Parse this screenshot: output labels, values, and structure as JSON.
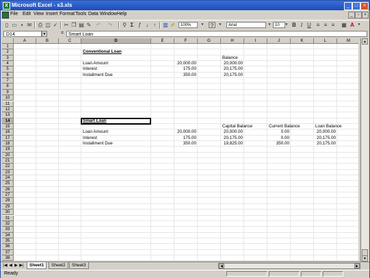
{
  "window": {
    "title": "Microsoft Excel - s3.xls"
  },
  "menu": [
    "File",
    "Edit",
    "View",
    "Insert",
    "Format",
    "Tools",
    "Data",
    "Window",
    "Help"
  ],
  "toolbar": {
    "zoom": "100%",
    "font": "Arial",
    "size": "10",
    "help": "?"
  },
  "formula_bar": {
    "name_box": "D14",
    "eq": "=",
    "content": "Smart Loan"
  },
  "columns": [
    "A",
    "B",
    "C",
    "D",
    "E",
    "F",
    "G",
    "H",
    "I",
    "J",
    "K",
    "L",
    "M",
    "N"
  ],
  "rows": [
    "1",
    "2",
    "3",
    "4",
    "5",
    "6",
    "7",
    "8",
    "9",
    "10",
    "11",
    "12",
    "13",
    "14",
    "15",
    "16",
    "17",
    "18",
    "19",
    "20",
    "21",
    "22",
    "23",
    "24",
    "25",
    "26",
    "27",
    "28",
    "29",
    "30",
    "31",
    "32",
    "33",
    "34",
    "35",
    "36",
    "37",
    "38"
  ],
  "cells": {
    "D2": "Conventional Loan",
    "H3": "Balance",
    "D4": "Loan Amount",
    "F4": "20,000.00",
    "H4": "20,000.00",
    "D5": "Interest",
    "F5": "175.00",
    "H5": "20,175.00",
    "D6": "Installment Due",
    "F6": "350.00",
    "H6": "20,175.00",
    "D14": "Smart Loan",
    "H15": "Capital Balance",
    "J15": "Current Balance",
    "L15": "Loan Balance",
    "D16": "Loan Amount",
    "F16": "20,000.00",
    "H16": "20,000.00",
    "J16": "0.00",
    "L16": "20,000.00",
    "D17": "Interest",
    "F17": "175.00",
    "H17": "20,175.00",
    "J17": "0.00",
    "L17": "20,175.00",
    "D18": "Installment Due",
    "F18": "350.00",
    "H18": "19,825.00",
    "J18": "350.00",
    "L18": "20,175.00"
  },
  "sheets": [
    "Sheet1",
    "Sheet2",
    "Sheet3"
  ],
  "active_sheet": "Sheet1",
  "status": "Ready"
}
